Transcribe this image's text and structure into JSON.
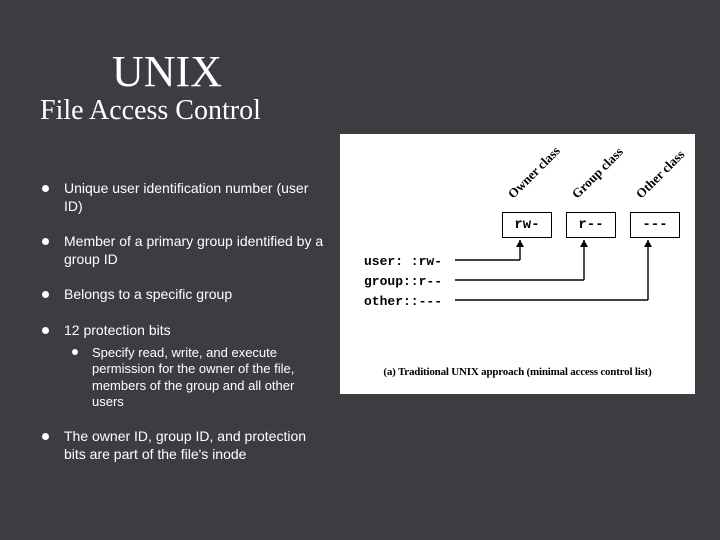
{
  "title": "UNIX",
  "subtitle": "File Access Control",
  "bullets": {
    "b0": "Unique user identification number (user ID)",
    "b1": "Member of a primary group identified by a group ID",
    "b2": "Belongs to a specific group",
    "b3": "12 protection bits",
    "b3_sub0": "Specify read, write, and execute permission for the owner of the file, members of the group and all other users",
    "b4": "The owner ID, group ID, and protection bits are part of the file's inode"
  },
  "diagram": {
    "class_labels": {
      "owner": "Owner class",
      "group": "Group class",
      "other": "Other class"
    },
    "perm_boxes": {
      "owner": "rw-",
      "group": "r--",
      "other": "---"
    },
    "user_labels": {
      "user": "user: :rw-",
      "group": "group::r--",
      "other": "other::---"
    },
    "caption": "(a) Traditional UNIX approach (minimal access control list)"
  }
}
